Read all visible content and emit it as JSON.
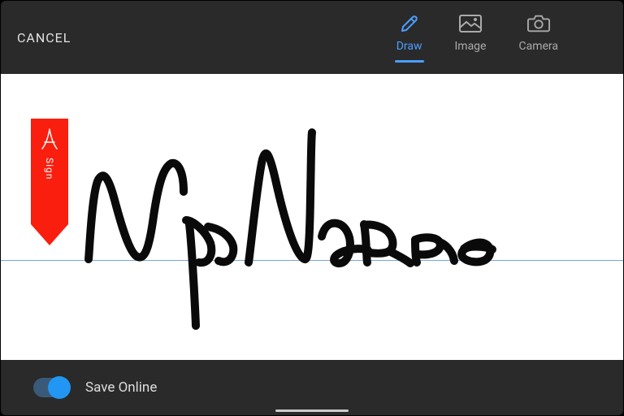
{
  "toolbar": {
    "cancel_label": "CANCEL",
    "tabs": {
      "draw": "Draw",
      "image": "Image",
      "camera": "Camera"
    }
  },
  "ribbon": {
    "label": "Sign"
  },
  "bottom": {
    "save_online_label": "Save Online"
  },
  "colors": {
    "accent_blue": "#4a9eff",
    "ribbon_red": "#fa1e0e",
    "toggle_on": "#2196f3"
  }
}
